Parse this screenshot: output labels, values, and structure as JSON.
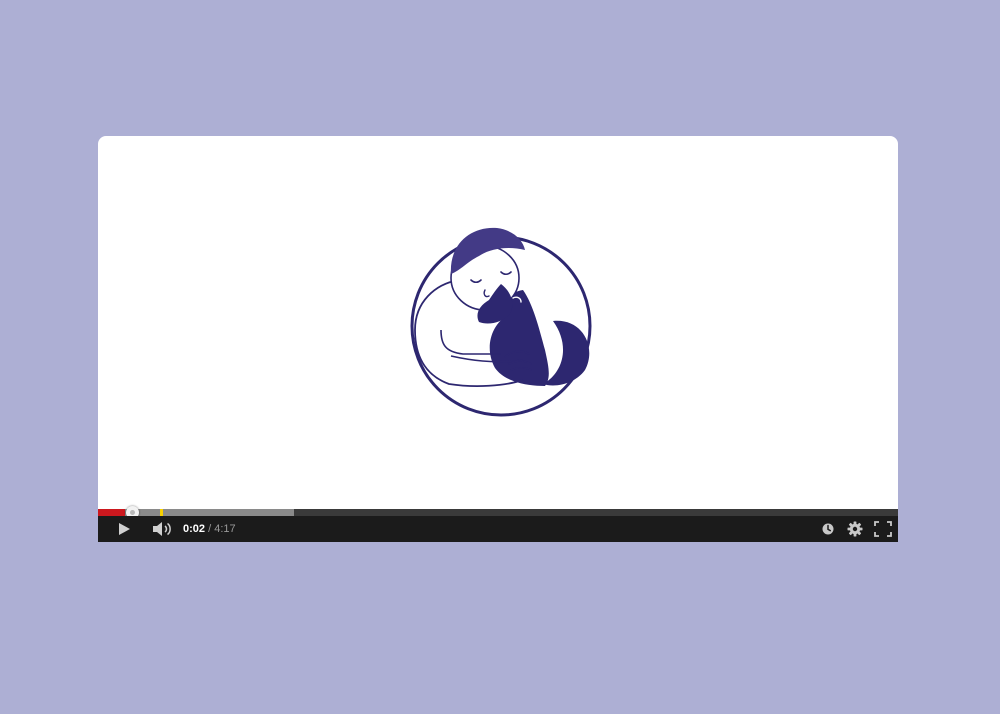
{
  "player": {
    "progress": {
      "played_fraction": 0.034,
      "loaded_fraction": 0.245,
      "scrubber_fraction": 0.042,
      "ad_marker_fraction": 0.077
    },
    "time": {
      "current": "0:02",
      "separator": " / ",
      "total": "4:17"
    }
  },
  "icons": {
    "play": "play-icon",
    "volume": "volume-icon",
    "watch_later": "clock-icon",
    "settings": "gear-icon",
    "fullscreen": "fullscreen-icon"
  },
  "colors": {
    "page_background": "#adafd4",
    "brand": "#2d2770",
    "played": "#cc181e",
    "ad_marker": "#f7d000",
    "controls_background": "#1b1b1b"
  }
}
